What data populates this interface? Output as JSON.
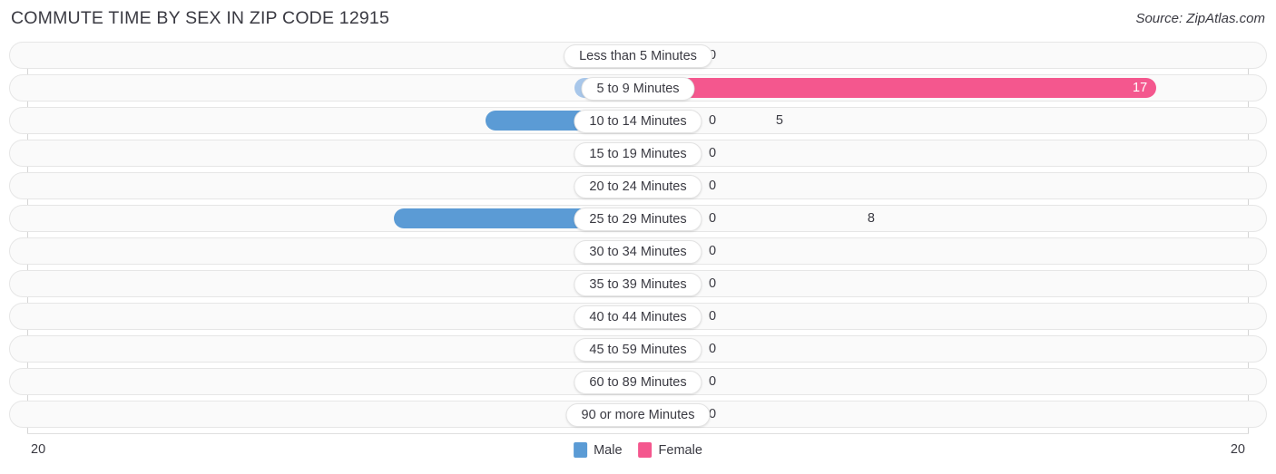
{
  "header": {
    "title": "COMMUTE TIME BY SEX IN ZIP CODE 12915",
    "source": "Source: ZipAtlas.com"
  },
  "legend": {
    "male_label": "Male",
    "female_label": "Female",
    "male_color": "#5B9BD5",
    "female_color": "#F4578E"
  },
  "axis": {
    "min_label": "20",
    "max_label": "20"
  },
  "colors": {
    "male_active": "#5B9BD5",
    "male_zero": "#A8C7EA",
    "female_active": "#F4578E",
    "female_zero": "#F79DC0",
    "track_bg": "#FAFAFA",
    "track_border": "#E6E6E6"
  },
  "chart_data": {
    "type": "bar",
    "orientation": "horizontal-diverging",
    "title": "COMMUTE TIME BY SEX IN ZIP CODE 12915",
    "xlabel": "",
    "ylabel": "",
    "xlim": [
      20,
      20
    ],
    "grid": false,
    "legend_position": "bottom-center",
    "categories": [
      "Less than 5 Minutes",
      "5 to 9 Minutes",
      "10 to 14 Minutes",
      "15 to 19 Minutes",
      "20 to 24 Minutes",
      "25 to 29 Minutes",
      "30 to 34 Minutes",
      "35 to 39 Minutes",
      "40 to 44 Minutes",
      "45 to 59 Minutes",
      "60 to 89 Minutes",
      "90 or more Minutes"
    ],
    "series": [
      {
        "name": "Male",
        "values": [
          0,
          0,
          5,
          0,
          0,
          8,
          0,
          0,
          0,
          0,
          0,
          0
        ]
      },
      {
        "name": "Female",
        "values": [
          0,
          17,
          0,
          0,
          0,
          0,
          0,
          0,
          0,
          0,
          0,
          0
        ]
      }
    ]
  },
  "rows": [
    {
      "label": "Less than 5 Minutes",
      "male": "0",
      "female": "0"
    },
    {
      "label": "5 to 9 Minutes",
      "male": "0",
      "female": "17"
    },
    {
      "label": "10 to 14 Minutes",
      "male": "5",
      "female": "0"
    },
    {
      "label": "15 to 19 Minutes",
      "male": "0",
      "female": "0"
    },
    {
      "label": "20 to 24 Minutes",
      "male": "0",
      "female": "0"
    },
    {
      "label": "25 to 29 Minutes",
      "male": "8",
      "female": "0"
    },
    {
      "label": "30 to 34 Minutes",
      "male": "0",
      "female": "0"
    },
    {
      "label": "35 to 39 Minutes",
      "male": "0",
      "female": "0"
    },
    {
      "label": "40 to 44 Minutes",
      "male": "0",
      "female": "0"
    },
    {
      "label": "45 to 59 Minutes",
      "male": "0",
      "female": "0"
    },
    {
      "label": "60 to 89 Minutes",
      "male": "0",
      "female": "0"
    },
    {
      "label": "90 or more Minutes",
      "male": "0",
      "female": "0"
    }
  ]
}
